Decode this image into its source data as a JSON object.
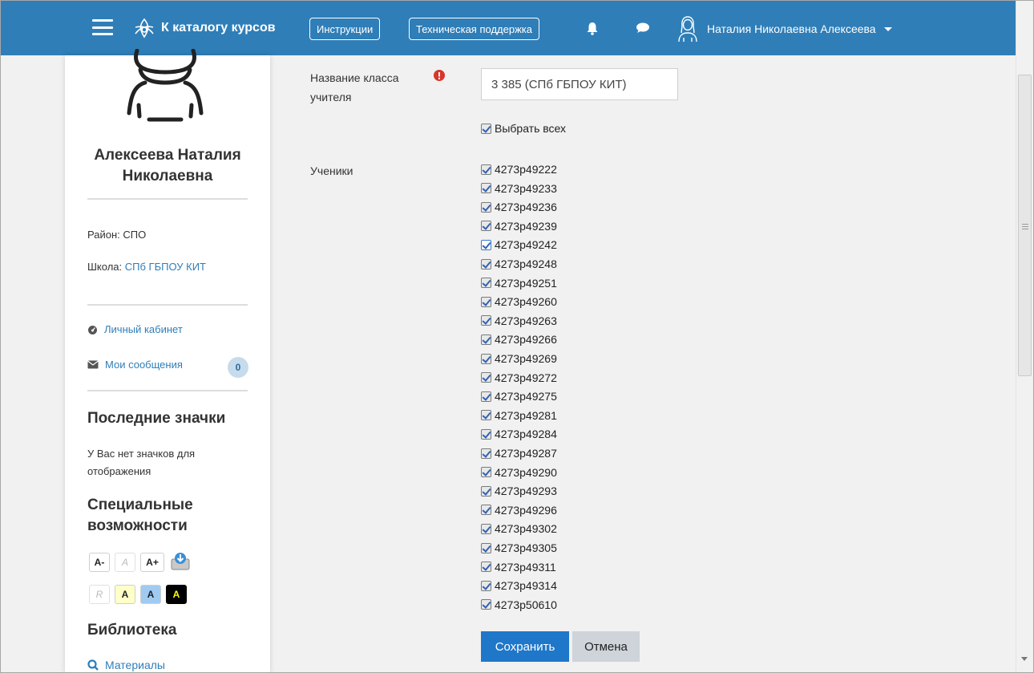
{
  "navbar": {
    "brand_label": "К каталогу курсов",
    "instructions_label": "Инструкции",
    "support_label": "Техническая поддержка",
    "user_name": "Наталия Николаевна Алексеева",
    "bg_color": "#2f7eb8"
  },
  "sidebar": {
    "full_name": "Алексеева Наталия Николаевна",
    "district": "Район: СПО",
    "school_prefix": "Школа: ",
    "school_link": "СПб ГБПОУ КИТ",
    "cabinet_link": "Личный кабинет",
    "messages_link": "Мои сообщения",
    "messages_count": "0",
    "badges_heading": "Последние значки",
    "badges_empty": "У Вас нет значков для отображения",
    "accessibility_heading": "Специальные возможности",
    "accessibility": {
      "decrease": "A-",
      "reset": "A",
      "increase": "A+",
      "reset_colors": "R",
      "scheme_yellow": "A",
      "scheme_blue": "A",
      "scheme_black": "A"
    },
    "library_heading": "Библиотека",
    "materials_link": "Материалы"
  },
  "form": {
    "class_name_label": "Название класса учителя",
    "class_name_value": "3 385 (СПб ГБПОУ КИТ)",
    "select_all_label": "Выбрать всех",
    "students_label": "Ученики",
    "students": [
      "4273p49222",
      "4273p49233",
      "4273p49236",
      "4273p49239",
      "4273p49242",
      "4273p49248",
      "4273p49251",
      "4273p49260",
      "4273p49263",
      "4273p49266",
      "4273p49269",
      "4273p49272",
      "4273p49275",
      "4273p49281",
      "4273p49284",
      "4273p49287",
      "4273p49290",
      "4273p49293",
      "4273p49296",
      "4273p49302",
      "4273p49305",
      "4273p49311",
      "4273p49314",
      "4273p50610"
    ],
    "save_label": "Сохранить",
    "cancel_label": "Отмена"
  }
}
